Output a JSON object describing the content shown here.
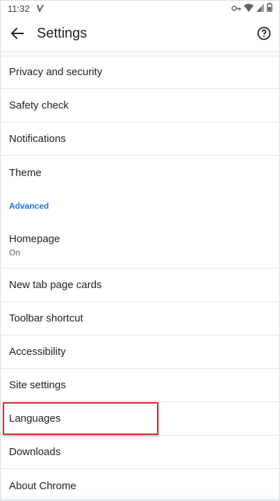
{
  "status_bar": {
    "time": "11:32"
  },
  "app_bar": {
    "title": "Settings"
  },
  "items": {
    "privacy": "Privacy and security",
    "safety": "Safety check",
    "notifications": "Notifications",
    "theme": "Theme",
    "advanced_header": "Advanced",
    "homepage": "Homepage",
    "homepage_sub": "On",
    "new_tab": "New tab page cards",
    "toolbar": "Toolbar shortcut",
    "accessibility": "Accessibility",
    "site_settings": "Site settings",
    "languages": "Languages",
    "downloads": "Downloads",
    "about": "About Chrome"
  },
  "colors": {
    "accent": "#1a73e8",
    "highlight": "#d32f2f"
  },
  "icons": {
    "back": "arrow-back-icon",
    "help": "help-circle-icon"
  }
}
